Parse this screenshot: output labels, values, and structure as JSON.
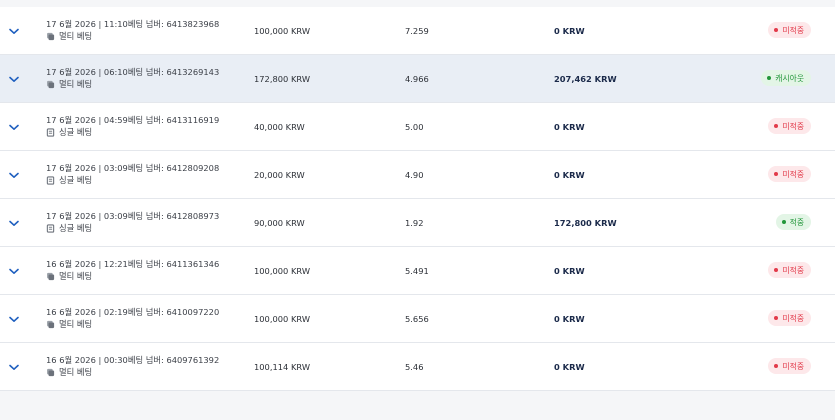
{
  "bets": [
    {
      "meta": "17 6월 2026 | 11:10베팅 넘버: 6413823968",
      "type_icon": "multi-bet-icon",
      "type": "멀티 베팅",
      "stake": "100,000 KRW",
      "odds": "7.259",
      "payout": "0 KRW",
      "status": "미적중",
      "status_kind": "lose"
    },
    {
      "meta": "17 6월 2026 | 06:10베팅 넘버: 6413269143",
      "type_icon": "multi-bet-icon",
      "type": "멀티 베팅",
      "stake": "172,800 KRW",
      "odds": "4.966",
      "payout": "207,462 KRW",
      "status": "캐시아웃",
      "status_kind": "win",
      "highlight": true
    },
    {
      "meta": "17 6월 2026 | 04:59베팅 넘버: 6413116919",
      "type_icon": "single-bet-icon",
      "type": "싱글 베팅",
      "stake": "40,000 KRW",
      "odds": "5.00",
      "payout": "0 KRW",
      "status": "미적중",
      "status_kind": "lose"
    },
    {
      "meta": "17 6월 2026 | 03:09베팅 넘버: 6412809208",
      "type_icon": "single-bet-icon",
      "type": "싱글 베팅",
      "stake": "20,000 KRW",
      "odds": "4.90",
      "payout": "0 KRW",
      "status": "미적중",
      "status_kind": "lose"
    },
    {
      "meta": "17 6월 2026 | 03:09베팅 넘버: 6412808973",
      "type_icon": "single-bet-icon",
      "type": "싱글 베팅",
      "stake": "90,000 KRW",
      "odds": "1.92",
      "payout": "172,800 KRW",
      "status": "적중",
      "status_kind": "win"
    },
    {
      "meta": "16 6월 2026 | 12:21베팅 넘버: 6411361346",
      "type_icon": "multi-bet-icon",
      "type": "멀티 베팅",
      "stake": "100,000 KRW",
      "odds": "5.491",
      "payout": "0 KRW",
      "status": "미적중",
      "status_kind": "lose"
    },
    {
      "meta": "16 6월 2026 | 02:19베팅 넘버: 6410097220",
      "type_icon": "multi-bet-icon",
      "type": "멀티 베팅",
      "stake": "100,000 KRW",
      "odds": "5.656",
      "payout": "0 KRW",
      "status": "미적중",
      "status_kind": "lose"
    },
    {
      "meta": "16 6월 2026 | 00:30베팅 넘버: 6409761392",
      "type_icon": "multi-bet-icon",
      "type": "멀티 베팅",
      "stake": "100,114 KRW",
      "odds": "5.46",
      "payout": "0 KRW",
      "status": "미적중",
      "status_kind": "lose"
    }
  ],
  "colors": {
    "chevron": "#1f5fbf",
    "lose_text": "#e23a4a",
    "win_text": "#22963a",
    "highlight_row": "#e9eef5"
  }
}
